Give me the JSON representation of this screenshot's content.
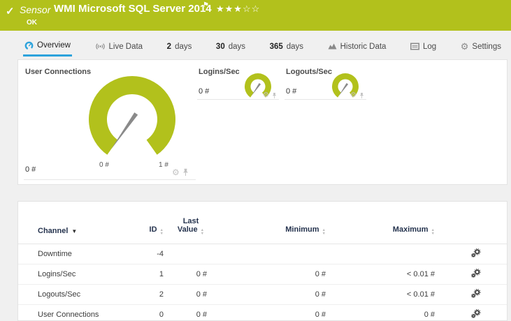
{
  "titlebar": {
    "kind": "Sensor",
    "title": "WMI Microsoft SQL Server 2014",
    "status": "OK",
    "stars_filled": "★★★",
    "stars_empty": "☆☆"
  },
  "tabs": [
    {
      "label": "Overview",
      "active": true
    },
    {
      "label": "Live Data"
    },
    {
      "num": "2",
      "label": "days"
    },
    {
      "num": "30",
      "label": "days"
    },
    {
      "num": "365",
      "label": "days"
    },
    {
      "label": "Historic Data"
    },
    {
      "label": "Log"
    },
    {
      "label": "Settings"
    }
  ],
  "overview_panel": {
    "main_gauge": {
      "title": "User Connections",
      "value": "0 #",
      "scale_min": "0 #",
      "scale_max": "1 #"
    },
    "small_gauges": [
      {
        "title": "Logins/Sec",
        "value": "0 #"
      },
      {
        "title": "Logouts/Sec",
        "value": "0 #"
      }
    ]
  },
  "channel_table": {
    "headers": {
      "channel": "Channel",
      "id": "ID",
      "last_value": "Last Value",
      "minimum": "Minimum",
      "maximum": "Maximum"
    },
    "rows": [
      {
        "channel": "Downtime",
        "id": "-4",
        "last_value": "",
        "minimum": "",
        "maximum": ""
      },
      {
        "channel": "Logins/Sec",
        "id": "1",
        "last_value": "0 #",
        "minimum": "0 #",
        "maximum": "< 0.01 #"
      },
      {
        "channel": "Logouts/Sec",
        "id": "2",
        "last_value": "0 #",
        "minimum": "0 #",
        "maximum": "< 0.01 #"
      },
      {
        "channel": "User Connections",
        "id": "0",
        "last_value": "0 #",
        "minimum": "0 #",
        "maximum": "0 #"
      }
    ]
  },
  "colors": {
    "accent_green": "#b2c11c",
    "accent_blue": "#2da3dc",
    "needle_gray": "#8a8a8a"
  }
}
